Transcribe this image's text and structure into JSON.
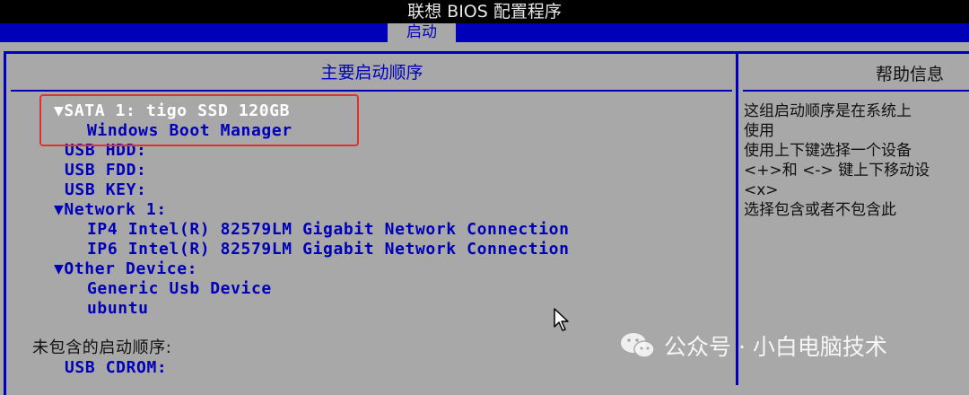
{
  "window": {
    "title": "联想 BIOS 配置程序",
    "active_tab": "启动"
  },
  "main": {
    "title": "主要启动顺序",
    "items": [
      {
        "text": "▼SATA 1: tigo SSD 120GB",
        "selected": true
      },
      {
        "text": "Windows Boot Manager"
      },
      {
        "text": "USB HDD:"
      },
      {
        "text": "USB FDD:"
      },
      {
        "text": "USB KEY:"
      },
      {
        "text": "▼Network 1:"
      },
      {
        "text": "IP4 Intel(R) 82579LM Gigabit Network Connection"
      },
      {
        "text": "IP6 Intel(R) 82579LM Gigabit Network Connection"
      },
      {
        "text": "▼Other Device:"
      },
      {
        "text": "Generic Usb Device"
      },
      {
        "text": "ubuntu"
      }
    ],
    "excluded_title": "未包含的启动顺序:",
    "excluded_items": [
      {
        "text": "USB CDROM:"
      }
    ]
  },
  "help": {
    "title": "帮助信息",
    "lines": [
      "这组启动顺序是在系统上",
      "使用",
      "使用上下键选择一个设备",
      "<+>和 <-> 键上下移动设",
      "<x>",
      "选择包含或者不包含此"
    ]
  },
  "watermark": {
    "text": "公众号 · 小白电脑技术",
    "icon": "wechat-icon"
  },
  "colors": {
    "background": "#a8a8a8",
    "accent_blue": "#0000b8",
    "selected_text": "#ffffff",
    "highlight_box": "#e03030"
  }
}
